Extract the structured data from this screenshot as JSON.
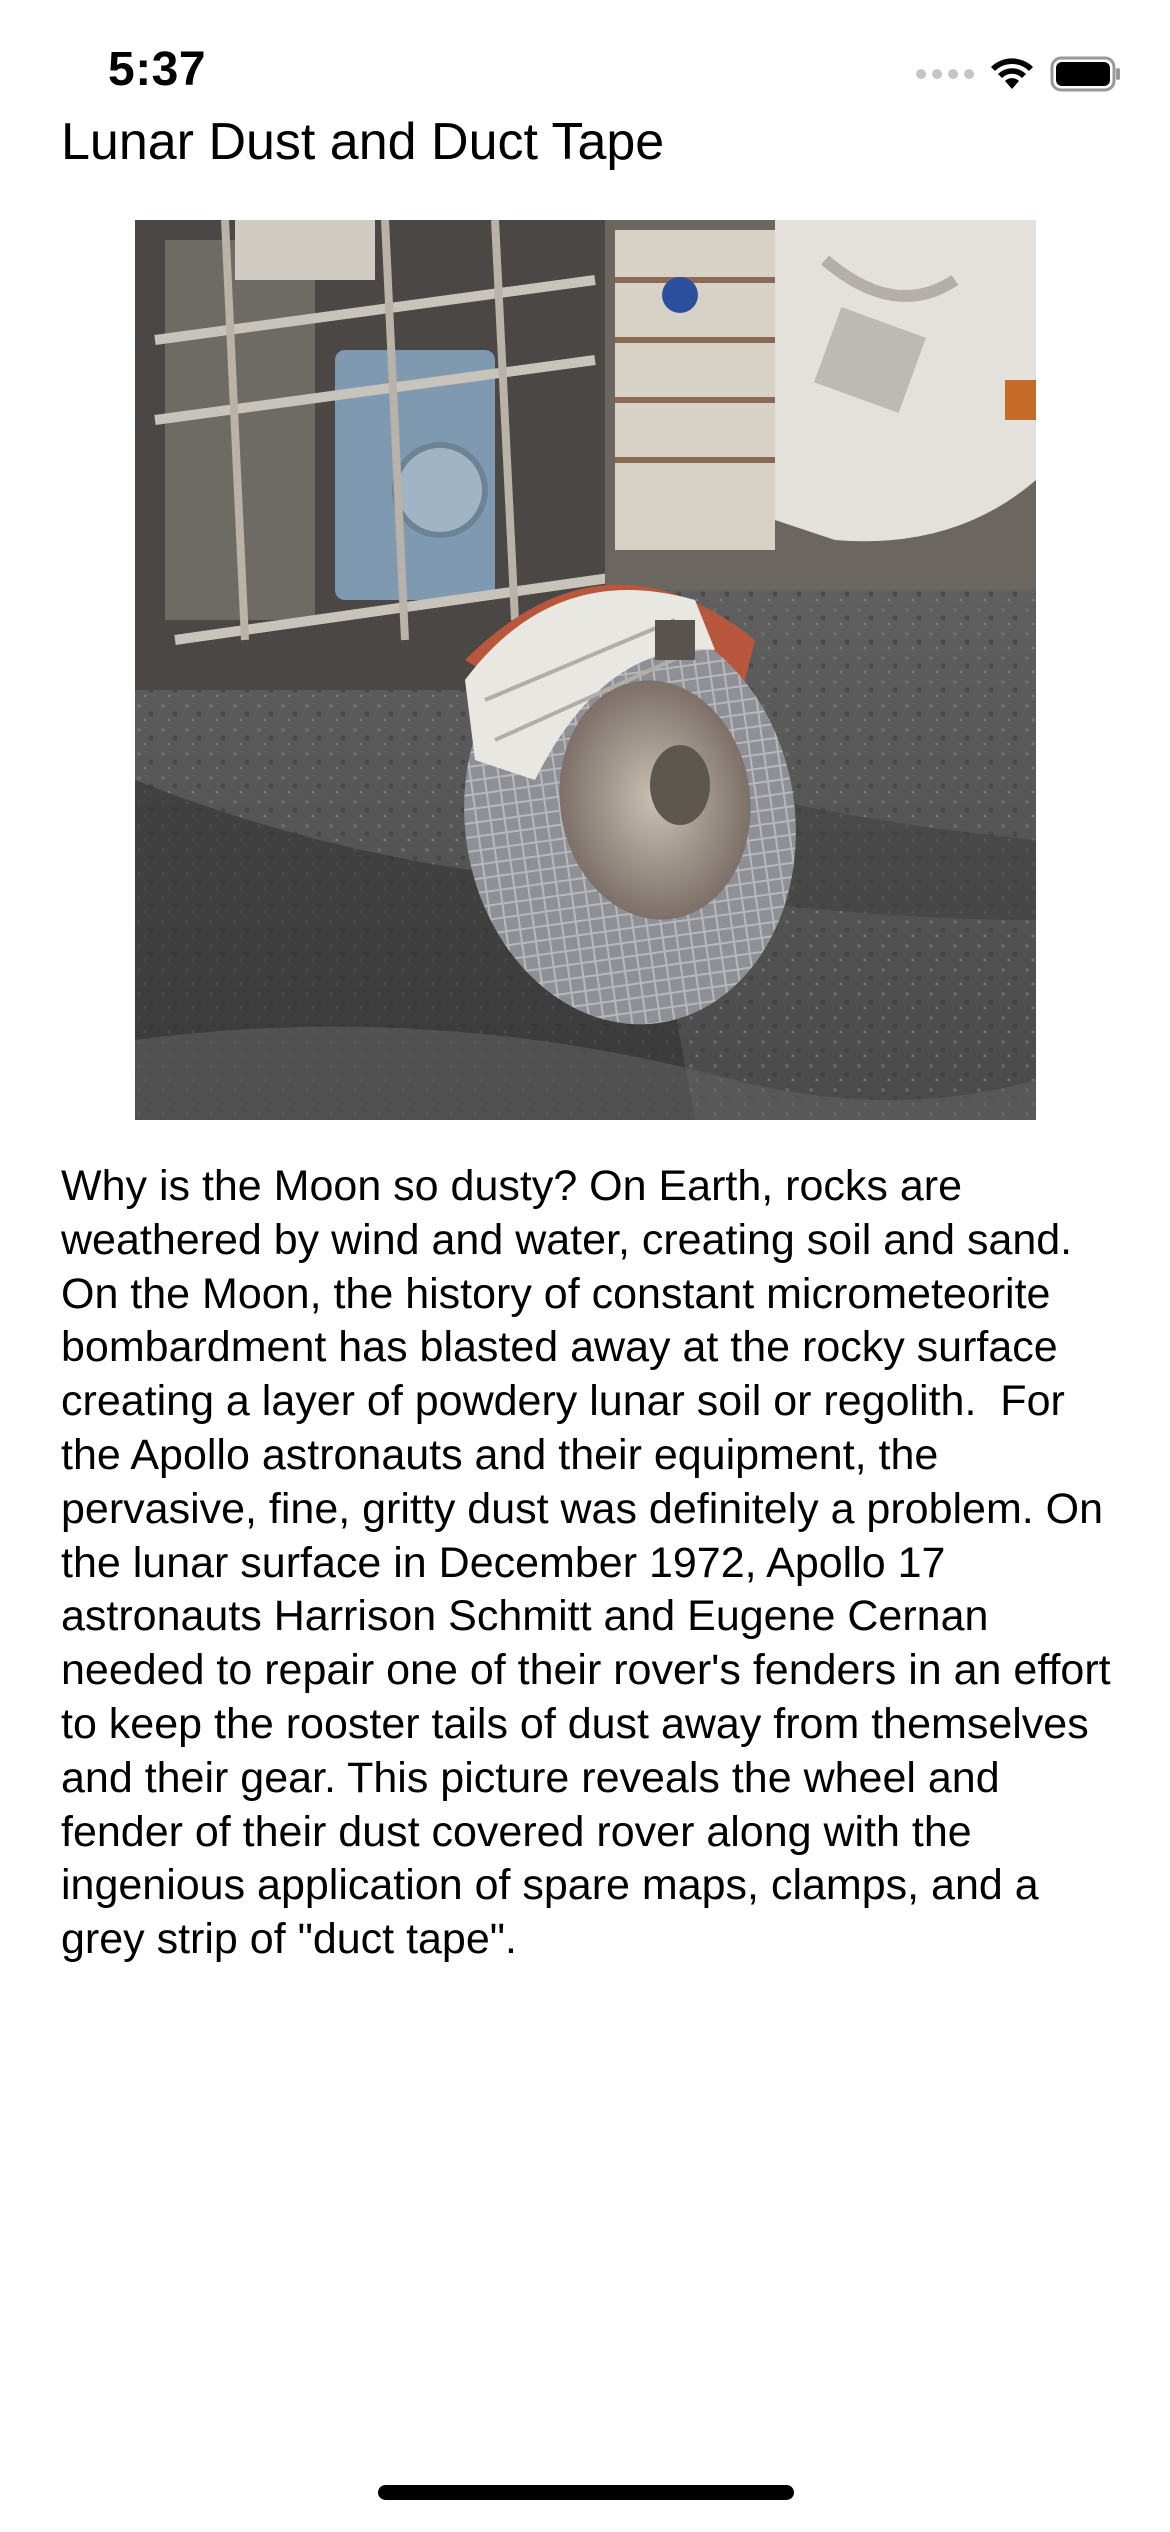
{
  "status_bar": {
    "time": "5:37",
    "icons": [
      "cellular-signal-icon",
      "wifi-icon",
      "battery-icon"
    ]
  },
  "header": {
    "title": "Lunar Dust and Duct Tape"
  },
  "image": {
    "name": "apollo-rover-fender-photo",
    "depicts": "lunar rover wheel with taped fender"
  },
  "content": {
    "explanation": "Why is the Moon so dusty? On Earth, rocks are weathered by wind and water, creating soil and sand. On the Moon, the history of constant micrometeorite bombardment has blasted away at the rocky surface creating a layer of powdery lunar soil or regolith.  For the Apollo astronauts and their equipment, the pervasive, fine, gritty dust was definitely a problem. On the lunar surface in December 1972, Apollo 17 astronauts Harrison Schmitt and Eugene Cernan needed to repair one of their rover's fenders in an effort to keep the rooster tails of dust away from themselves and their gear. This picture reveals the wheel and fender of their dust covered rover along with the ingenious application of spare maps, clamps, and a grey strip of \"duct tape\"."
  },
  "colors": {
    "background": "#ffffff",
    "text": "#000000",
    "signal_inactive": "#c4c4c4"
  }
}
